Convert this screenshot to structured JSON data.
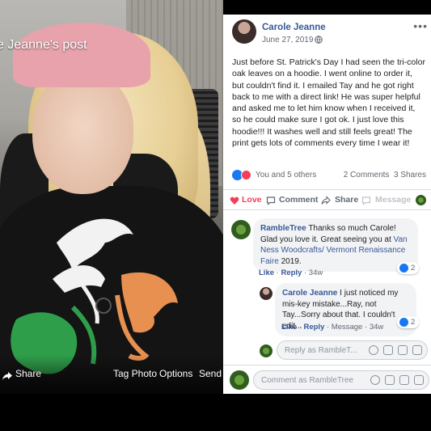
{
  "viewer": {
    "post_title": "e Jeanne's post",
    "share_label": "Share",
    "tag_label": "Tag Photo",
    "options_label": "Options",
    "send_label": "Send i"
  },
  "post": {
    "author": "Carole Jeanne",
    "date": "June 27, 2019",
    "more": "•••",
    "text": "Just before St. Patrick's Day I had seen the tri-color oak leaves on a hoodie. I went online to order it, but couldn't find it. I emailed Tay and he got right back to me with a direct link! He was super helpful and asked me to let him know when I received it, so he could make sure I got ok. I just love this hoodie!!! It washes well and still feels great! The print gets lots of comments every time I wear it!",
    "reactions_text": "You and 5 others",
    "comments_count": "2 Comments",
    "shares_count": "3 Shares"
  },
  "actions": {
    "love": "Love",
    "comment": "Comment",
    "share": "Share",
    "message": "Message"
  },
  "comments": [
    {
      "author": "RambleTree",
      "text": "Thanks so much Carole! Glad you love it. Great seeing you at",
      "link": "Van Ness Woodcrafts/ Vermont Renaissance Faire",
      "text_after": "2019.",
      "like": "Like",
      "reply": "Reply",
      "time": "34w",
      "likes": "2"
    },
    {
      "author": "Carole Jeanne",
      "text": "I just noticed my mis-key mistake...Ray, not Tay...Sorry about that. I couldn't edit...",
      "like": "Like",
      "reply": "Reply",
      "message": "Message",
      "time": "34w",
      "likes": "2"
    }
  ],
  "reply_placeholder": "Reply as RambleT...",
  "comment_placeholder": "Comment as RambleTree",
  "colors": {
    "link": "#385898",
    "love": "#f33e58",
    "like": "#1877f2"
  }
}
